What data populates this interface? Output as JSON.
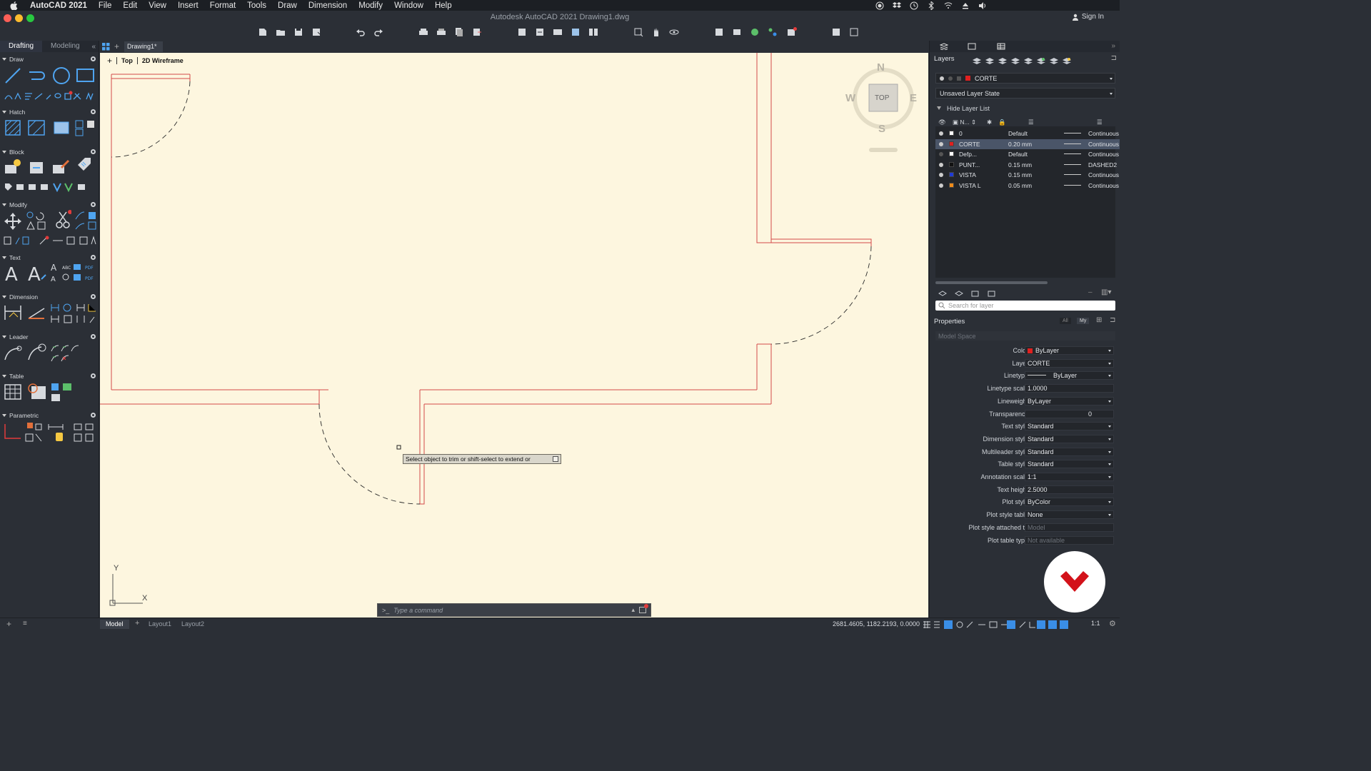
{
  "menubar": {
    "app_name": "AutoCAD 2021",
    "items": [
      "File",
      "Edit",
      "View",
      "Insert",
      "Format",
      "Tools",
      "Draw",
      "Dimension",
      "Modify",
      "Window",
      "Help"
    ]
  },
  "window": {
    "title": "Autodesk AutoCAD 2021   Drawing1.dwg",
    "sign_in": "Sign In"
  },
  "left_panel": {
    "tabs": [
      "Drafting",
      "Modeling"
    ],
    "sections": [
      "Draw",
      "Hatch",
      "Block",
      "Modify",
      "Text",
      "Dimension",
      "Leader",
      "Table",
      "Parametric"
    ]
  },
  "document": {
    "tab": "Drawing1*",
    "view": "Top",
    "visual_style": "2D Wireframe"
  },
  "viewcube": {
    "north": "N",
    "south": "S",
    "east": "E",
    "west": "W",
    "face": "TOP"
  },
  "ucs": {
    "y": "Y",
    "x": "X"
  },
  "tooltip": "Select object to trim or shift-select to extend or",
  "command_line": {
    "placeholder": "Type a command",
    "prompt": ">_"
  },
  "layers_panel": {
    "title": "Layers",
    "current_layer": "CORTE",
    "layer_state": "Unsaved Layer State",
    "hide_list": "Hide Layer List",
    "col_name": "N...",
    "rows": [
      {
        "name": "0",
        "lineweight": "Default",
        "linetype": "Continuous",
        "color": "#ffffff",
        "selected": false
      },
      {
        "name": "CORTE",
        "lineweight": "0.20 mm",
        "linetype": "Continuous",
        "color": "#e02020",
        "selected": true
      },
      {
        "name": "Defp...",
        "lineweight": "Default",
        "linetype": "Continuous",
        "color": "#ffffff",
        "selected": false
      },
      {
        "name": "PUNT...",
        "lineweight": "0.15 mm",
        "linetype": "DASHED2",
        "color": "#111111",
        "selected": false
      },
      {
        "name": "VISTA",
        "lineweight": "0.15 mm",
        "linetype": "Continuous",
        "color": "#1f3bd6",
        "selected": false
      },
      {
        "name": "VISTA L",
        "lineweight": "0.05 mm",
        "linetype": "Continuous",
        "color": "#f08c1a",
        "selected": false
      }
    ],
    "search_placeholder": "Search for layer"
  },
  "properties": {
    "title": "Properties",
    "filter_all": "All",
    "filter_my": "My",
    "space": "Model Space",
    "rows": [
      {
        "label": "Color",
        "value": "ByLayer"
      },
      {
        "label": "Layer",
        "value": "CORTE"
      },
      {
        "label": "Linetype",
        "value": "ByLayer"
      },
      {
        "label": "Linetype scale",
        "value": "1.0000"
      },
      {
        "label": "Lineweight",
        "value": "ByLayer"
      },
      {
        "label": "Transparency",
        "value": "0"
      },
      {
        "label": "Text style",
        "value": "Standard"
      },
      {
        "label": "Dimension style",
        "value": "Standard"
      },
      {
        "label": "Multileader style",
        "value": "Standard"
      },
      {
        "label": "Table style",
        "value": "Standard"
      },
      {
        "label": "Annotation scale",
        "value": "1:1"
      },
      {
        "label": "Text height",
        "value": "2.5000"
      },
      {
        "label": "Plot style",
        "value": "ByColor"
      },
      {
        "label": "Plot style table",
        "value": "None"
      },
      {
        "label": "Plot style attached to",
        "value": "Model"
      },
      {
        "label": "Plot table type",
        "value": "Not available"
      }
    ]
  },
  "statusbar": {
    "tabs": [
      "Model",
      "Layout1",
      "Layout2"
    ],
    "coordinates": "2681.4605, 1182.2193, 0.0000",
    "scale": "1:1"
  },
  "colors": {
    "canvas": "#fdf6df",
    "line": "#d44a4a",
    "accent": "#4a5568"
  }
}
